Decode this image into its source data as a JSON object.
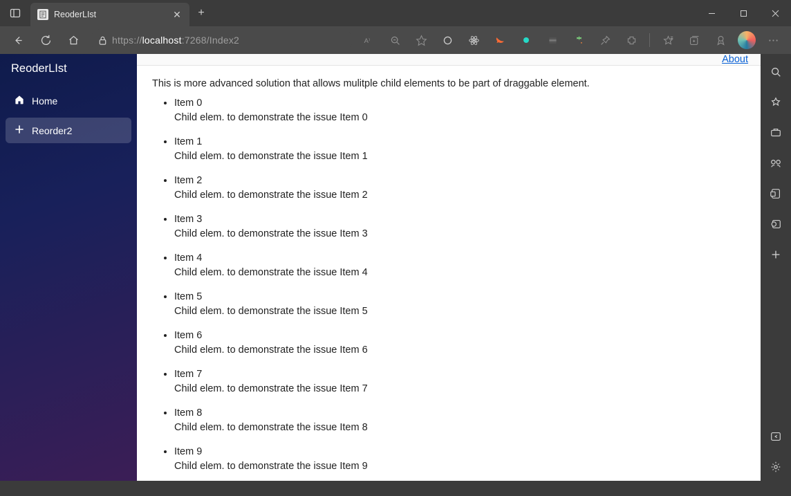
{
  "browser": {
    "tab_title": "ReoderLIst",
    "url": {
      "scheme": "https://",
      "host": "localhost",
      "rest": ":7268/Index2"
    },
    "window_controls": {
      "minimize": "−",
      "maximize": "▢",
      "close": "✕"
    }
  },
  "app": {
    "brand": "ReoderLIst",
    "about_label": "About",
    "nav": [
      {
        "icon": "home",
        "label": "Home",
        "active": false
      },
      {
        "icon": "plus",
        "label": "Reorder2",
        "active": true
      }
    ],
    "intro": "This is more advanced solution that allows mulitple child elements to be part of draggable element.",
    "items": [
      {
        "title": "Item 0",
        "child": "Child elem. to demonstrate the issue Item 0"
      },
      {
        "title": "Item 1",
        "child": "Child elem. to demonstrate the issue Item 1"
      },
      {
        "title": "Item 2",
        "child": "Child elem. to demonstrate the issue Item 2"
      },
      {
        "title": "Item 3",
        "child": "Child elem. to demonstrate the issue Item 3"
      },
      {
        "title": "Item 4",
        "child": "Child elem. to demonstrate the issue Item 4"
      },
      {
        "title": "Item 5",
        "child": "Child elem. to demonstrate the issue Item 5"
      },
      {
        "title": "Item 6",
        "child": "Child elem. to demonstrate the issue Item 6"
      },
      {
        "title": "Item 7",
        "child": "Child elem. to demonstrate the issue Item 7"
      },
      {
        "title": "Item 8",
        "child": "Child elem. to demonstrate the issue Item 8"
      },
      {
        "title": "Item 9",
        "child": "Child elem. to demonstrate the issue Item 9"
      }
    ]
  }
}
